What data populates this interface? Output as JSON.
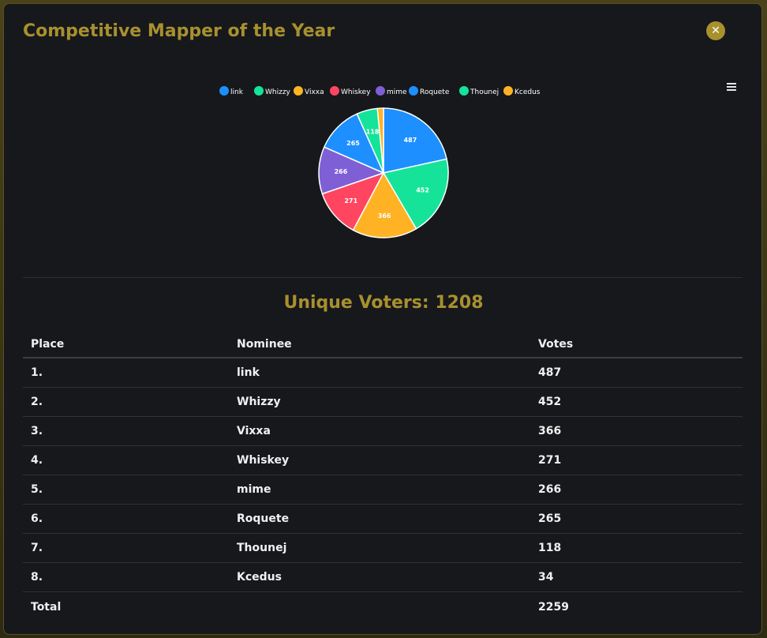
{
  "modal": {
    "title": "Competitive Mapper of the Year",
    "close_icon": "close-icon",
    "menu_icon": "hamburger-menu-icon"
  },
  "chart_data": {
    "type": "pie",
    "categories": [
      "link",
      "Whizzy",
      "Vixxa",
      "Whiskey",
      "mime",
      "Roquete",
      "Thounej",
      "Kcedus"
    ],
    "values": [
      487,
      452,
      366,
      271,
      266,
      265,
      118,
      34
    ],
    "colors": [
      "#1e8fff",
      "#16e39a",
      "#ffb324",
      "#ff4560",
      "#7f5fd6",
      "#1e8fff",
      "#16e39a",
      "#ffb324"
    ],
    "legend": "top-center",
    "data_labels": [
      "487",
      "452",
      "366",
      "271",
      "266",
      "265",
      "118",
      ""
    ]
  },
  "summary": {
    "voters_label": "Unique Voters:",
    "voters_value": "1208"
  },
  "table": {
    "headers": [
      "Place",
      "Nominee",
      "Votes"
    ],
    "rows": [
      {
        "place": "1.",
        "nominee": "link",
        "votes": "487"
      },
      {
        "place": "2.",
        "nominee": "Whizzy",
        "votes": "452"
      },
      {
        "place": "3.",
        "nominee": "Vixxa",
        "votes": "366"
      },
      {
        "place": "4.",
        "nominee": "Whiskey",
        "votes": "271"
      },
      {
        "place": "5.",
        "nominee": "mime",
        "votes": "266"
      },
      {
        "place": "6.",
        "nominee": "Roquete",
        "votes": "265"
      },
      {
        "place": "7.",
        "nominee": "Thounej",
        "votes": "118"
      },
      {
        "place": "8.",
        "nominee": "Kcedus",
        "votes": "34"
      }
    ],
    "total_label": "Total",
    "total_value": "2259"
  }
}
